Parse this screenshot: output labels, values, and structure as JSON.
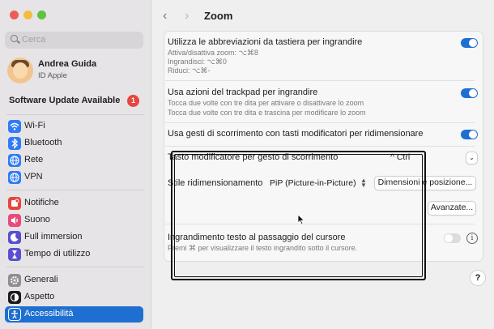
{
  "sidebar": {
    "search_placeholder": "Cerca",
    "user_name": "Andrea Guida",
    "user_sub": "ID Apple",
    "update_label": "Software Update Available",
    "update_badge": "1",
    "items": [
      {
        "label": "Wi-Fi",
        "icon": "wifi-icon",
        "color": "#2f7cf6"
      },
      {
        "label": "Bluetooth",
        "icon": "bluetooth-icon",
        "color": "#2f7cf6"
      },
      {
        "label": "Rete",
        "icon": "globe-icon",
        "color": "#2f7cf6"
      },
      {
        "label": "VPN",
        "icon": "globe-icon",
        "color": "#2f7cf6"
      },
      {
        "label": "Notifiche",
        "icon": "bell-icon",
        "color": "#e8453c"
      },
      {
        "label": "Suono",
        "icon": "speaker-icon",
        "color": "#e84a7a"
      },
      {
        "label": "Full immersion",
        "icon": "moon-icon",
        "color": "#5a4fcf"
      },
      {
        "label": "Tempo di utilizzo",
        "icon": "hourglass-icon",
        "color": "#5a4fcf"
      },
      {
        "label": "Generali",
        "icon": "gear-icon",
        "color": "#8e8e93"
      },
      {
        "label": "Aspetto",
        "icon": "appearance-icon",
        "color": "#1c1c1e"
      },
      {
        "label": "Accessibilità",
        "icon": "accessibility-icon",
        "color": "#1e6fd1",
        "selected": true
      }
    ]
  },
  "header": {
    "title": "Zoom",
    "back": "‹",
    "forward": "›"
  },
  "rows": {
    "kbd_title": "Utilizza le abbreviazioni da tastiera per ingrandire",
    "kbd_line1": "Attiva/disattiva zoom: ⌥⌘8",
    "kbd_line2": "Ingrandisci: ⌥⌘0",
    "kbd_line3": "Riduci: ⌥⌘-",
    "trackpad_title": "Usa azioni del trackpad per ingrandire",
    "trackpad_line1": "Tocca due volte con tre dita per attivare o disattivare lo zoom",
    "trackpad_line2": "Tocca due volte con tre dita e trascina per modificare lo zoom",
    "scroll_title": "Usa gesti di scorrimento con tasti modificatori per ridimensionare",
    "modifier_label": "Tasto modificatore per gesto di scorrimento",
    "modifier_value": "^ Ctrl",
    "style_label": "Stile ridimensionamento",
    "style_value": "PiP (Picture-in-Picture)",
    "size_button": "Dimensioni e posizione...",
    "advanced_button": "Avanzate...",
    "hover_title": "Ingrandimento testo al passaggio del cursore",
    "hover_sub": "Premi ⌘ per visualizzare il testo ingrandito sotto il cursore."
  },
  "help": "?",
  "info": "i",
  "colors": {
    "accent": "#1e6fd1",
    "sidebar_bg": "#e6e4e6"
  }
}
